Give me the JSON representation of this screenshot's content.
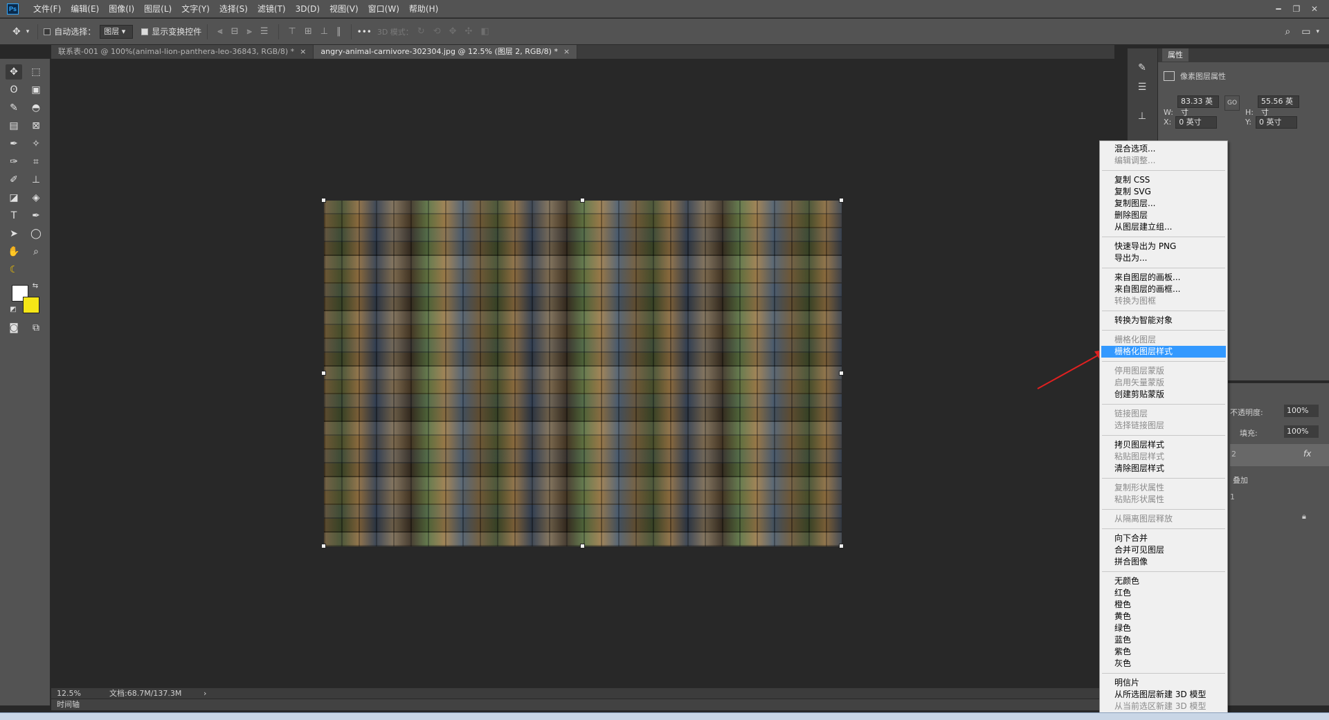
{
  "menubar": {
    "logo": "Ps",
    "items": [
      "文件(F)",
      "编辑(E)",
      "图像(I)",
      "图层(L)",
      "文字(Y)",
      "选择(S)",
      "滤镜(T)",
      "3D(D)",
      "视图(V)",
      "窗口(W)",
      "帮助(H)"
    ]
  },
  "options": {
    "auto_select_label": "自动选择：",
    "auto_select_value": "图层",
    "show_transform_label": "显示变换控件",
    "mode_3d_label": "3D 模式：",
    "more": "•••"
  },
  "tabs": [
    {
      "label": "联系表-001 @ 100%(animal-lion-panthera-leo-36843, RGB/8) *",
      "close": "×"
    },
    {
      "label": "angry-animal-carnivore-302304.jpg @ 12.5% (图层 2, RGB/8) *",
      "close": "×"
    }
  ],
  "status": {
    "zoom": "12.5%",
    "doc": "文档:68.7M/137.3M",
    "arrow": "›",
    "timeline": "时间轴"
  },
  "properties": {
    "tab": "属性",
    "title": "像素图层属性",
    "w_label": "W:",
    "w_value": "83.33 英寸",
    "h_label": "H:",
    "h_value": "55.56 英寸",
    "x_label": "X:",
    "x_value": "0 英寸",
    "y_label": "Y:",
    "y_value": "0 英寸",
    "link": "GO"
  },
  "layers": {
    "opacity_label": "不透明度:",
    "opacity_value": "100%",
    "fill_label": "填充:",
    "fill_value": "100%",
    "fx": "fx",
    "overlay_text": "叠加",
    "layer_name_partial": "2",
    "item_partial": "1"
  },
  "context_menu": [
    {
      "label": "混合选项...",
      "state": "enabled"
    },
    {
      "label": "编辑调整...",
      "state": "disabled"
    },
    {
      "sep": true
    },
    {
      "label": "复制 CSS",
      "state": "enabled"
    },
    {
      "label": "复制 SVG",
      "state": "enabled"
    },
    {
      "label": "复制图层...",
      "state": "enabled"
    },
    {
      "label": "删除图层",
      "state": "enabled"
    },
    {
      "label": "从图层建立组...",
      "state": "enabled"
    },
    {
      "sep": true
    },
    {
      "label": "快速导出为 PNG",
      "state": "enabled"
    },
    {
      "label": "导出为...",
      "state": "enabled"
    },
    {
      "sep": true
    },
    {
      "label": "来自图层的画板...",
      "state": "enabled"
    },
    {
      "label": "来自图层的画框...",
      "state": "enabled"
    },
    {
      "label": "转换为图框",
      "state": "disabled"
    },
    {
      "sep": true
    },
    {
      "label": "转换为智能对象",
      "state": "enabled"
    },
    {
      "sep": true
    },
    {
      "label": "栅格化图层",
      "state": "disabled"
    },
    {
      "label": "栅格化图层样式",
      "state": "highlighted"
    },
    {
      "sep": true
    },
    {
      "label": "停用图层蒙版",
      "state": "disabled"
    },
    {
      "label": "启用矢量蒙版",
      "state": "disabled"
    },
    {
      "label": "创建剪贴蒙版",
      "state": "enabled"
    },
    {
      "sep": true
    },
    {
      "label": "链接图层",
      "state": "disabled"
    },
    {
      "label": "选择链接图层",
      "state": "disabled"
    },
    {
      "sep": true
    },
    {
      "label": "拷贝图层样式",
      "state": "enabled"
    },
    {
      "label": "粘贴图层样式",
      "state": "disabled"
    },
    {
      "label": "清除图层样式",
      "state": "enabled"
    },
    {
      "sep": true
    },
    {
      "label": "复制形状属性",
      "state": "disabled"
    },
    {
      "label": "粘贴形状属性",
      "state": "disabled"
    },
    {
      "sep": true
    },
    {
      "label": "从隔离图层释放",
      "state": "disabled"
    },
    {
      "sep": true
    },
    {
      "label": "向下合并",
      "state": "enabled"
    },
    {
      "label": "合并可见图层",
      "state": "enabled"
    },
    {
      "label": "拼合图像",
      "state": "enabled"
    },
    {
      "sep": true
    },
    {
      "label": "无颜色",
      "state": "enabled"
    },
    {
      "label": "红色",
      "state": "enabled"
    },
    {
      "label": "橙色",
      "state": "enabled"
    },
    {
      "label": "黄色",
      "state": "enabled"
    },
    {
      "label": "绿色",
      "state": "enabled"
    },
    {
      "label": "蓝色",
      "state": "enabled"
    },
    {
      "label": "紫色",
      "state": "enabled"
    },
    {
      "label": "灰色",
      "state": "enabled"
    },
    {
      "sep": true
    },
    {
      "label": "明信片",
      "state": "enabled"
    },
    {
      "label": "从所选图层新建 3D 模型",
      "state": "enabled"
    },
    {
      "label": "从当前选区新建 3D 模型",
      "state": "disabled"
    }
  ],
  "colors": {
    "foreground": "#ffffff",
    "background": "#f5e617",
    "highlight": "#3399ff",
    "annotation_arrow": "#e02020"
  }
}
